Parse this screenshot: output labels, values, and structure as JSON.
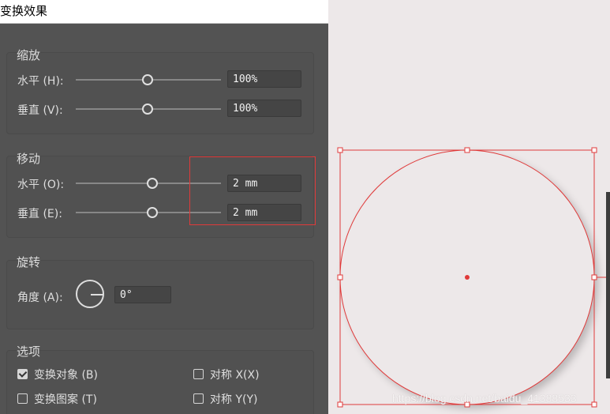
{
  "dialog": {
    "title": "变换效果",
    "scale": {
      "title": "缩放",
      "horizontal": {
        "label": "水平 (H):",
        "value": "100%"
      },
      "vertical": {
        "label": "垂直 (V):",
        "value": "100%"
      }
    },
    "move": {
      "title": "移动",
      "horizontal": {
        "label": "水平 (O):",
        "value": "2 mm"
      },
      "vertical": {
        "label": "垂直 (E):",
        "value": "2 mm"
      }
    },
    "rotate": {
      "title": "旋转",
      "angle": {
        "label": "角度 (A):",
        "value": "0°"
      }
    },
    "options": {
      "title": "选项",
      "transform_objects": {
        "label": "变换对象 (B)",
        "checked": true
      },
      "reflect_x": {
        "label": "对称 X(X)",
        "checked": false
      },
      "transform_patterns": {
        "label": "变换图案 (T)",
        "checked": false
      },
      "reflect_y": {
        "label": "对称 Y(Y)",
        "checked": false
      }
    }
  },
  "canvas": {
    "watermark": "https://blog.csdn.net/baidu_41388533"
  },
  "colors": {
    "panel": "#535353",
    "selection": "#e03a3a",
    "canvas_bg": "#ede8e9"
  }
}
